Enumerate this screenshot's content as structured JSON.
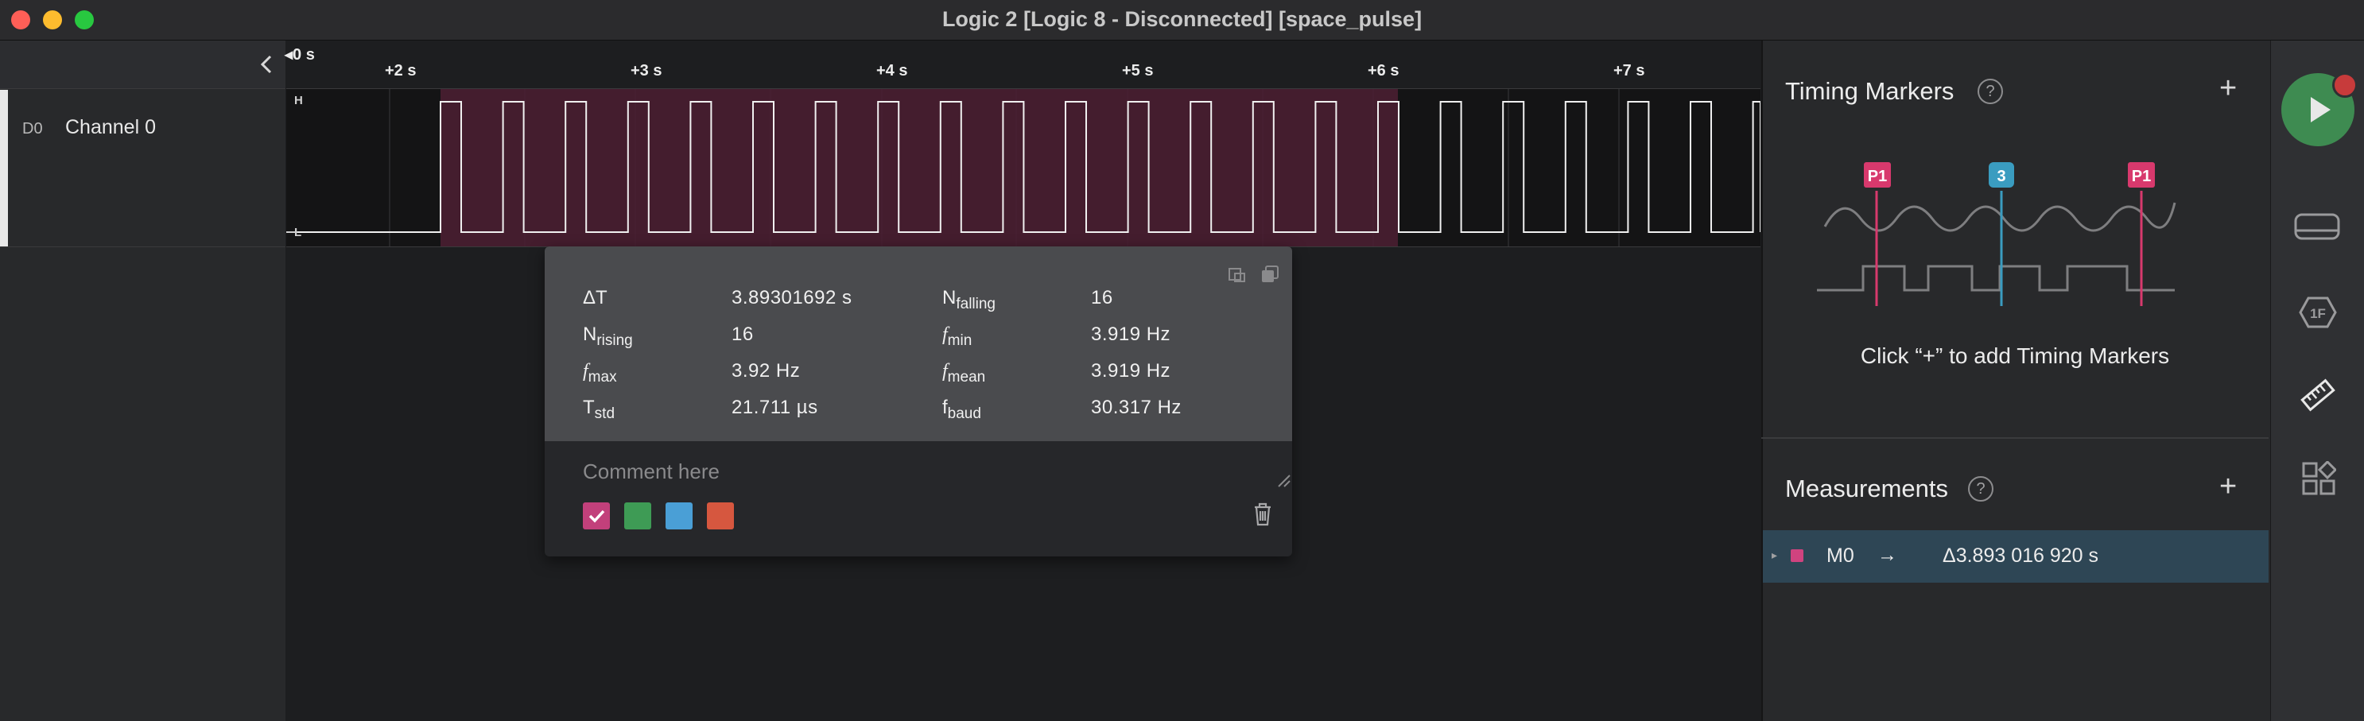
{
  "window": {
    "title": "Logic 2 [Logic 8 - Disconnected] [space_pulse]",
    "traffic_colors": [
      "#fe5f57",
      "#febc2e",
      "#28c840"
    ]
  },
  "channel": {
    "id": "D0",
    "name": "Channel 0",
    "high_label": "H",
    "low_label": "L"
  },
  "ruler": {
    "ticks": [
      "0 s",
      "+2 s",
      "+3 s",
      "+4 s",
      "+5 s",
      "+6 s",
      "+7 s"
    ]
  },
  "measurement_popup": {
    "rows": [
      {
        "label": "ΔT",
        "sub": "",
        "italic": false,
        "value": "3.89301692 s"
      },
      {
        "label": "N",
        "sub": "falling",
        "italic": false,
        "value": "16"
      },
      {
        "label": "N",
        "sub": "rising",
        "italic": false,
        "value": "16"
      },
      {
        "label": "f",
        "sub": "min",
        "italic": true,
        "value": "3.919 Hz"
      },
      {
        "label": "f",
        "sub": "max",
        "italic": true,
        "value": "3.92 Hz"
      },
      {
        "label": "f",
        "sub": "mean",
        "italic": true,
        "value": "3.919 Hz"
      },
      {
        "label": "T",
        "sub": "std",
        "italic": false,
        "value": "21.711 µs"
      },
      {
        "label": "f",
        "sub": "baud",
        "italic": false,
        "value": "30.317 Hz"
      }
    ],
    "comment_placeholder": "Comment here",
    "swatch_colors": [
      "#c2407b",
      "#3e9b55",
      "#4a9fd6",
      "#d6573f"
    ],
    "selected_swatch": 0
  },
  "timing_markers": {
    "title": "Timing Markers",
    "help": "?",
    "add": "+",
    "illustration_labels": [
      "P1",
      "3",
      "P1"
    ],
    "hint": "Click “+” to add Timing Markers"
  },
  "measurements": {
    "title": "Measurements",
    "help": "?",
    "add": "+",
    "items": [
      {
        "name": "M0",
        "arrow": "→",
        "value": "Δ3.893 016 920 s",
        "color": "#d0437f"
      }
    ]
  },
  "sidebar_icons": [
    "play-icon",
    "device-icon",
    "analyzer-1f-icon",
    "ruler-icon",
    "extensions-icon"
  ]
}
